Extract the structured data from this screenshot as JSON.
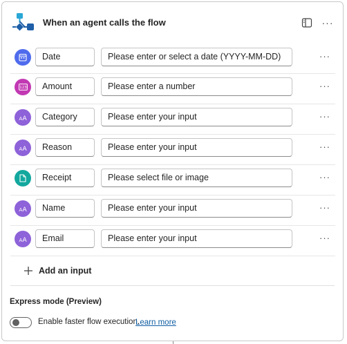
{
  "header": {
    "title": "When an agent calls the flow",
    "icon": "agent-trigger-icon",
    "panel_icon": "panel-toggle-icon",
    "more_label": "···"
  },
  "inputs": [
    {
      "name": "Date",
      "hint": "Please enter or select a date (YYYY-MM-DD)",
      "icon": "calendar-icon",
      "color": "#4f6bed"
    },
    {
      "name": "Amount",
      "hint": "Please enter a number",
      "icon": "number-icon",
      "color": "#c239b3"
    },
    {
      "name": "Category",
      "hint": "Please enter your input",
      "icon": "text-icon",
      "color": "#8e62d9"
    },
    {
      "name": "Reason",
      "hint": "Please enter your input",
      "icon": "text-icon",
      "color": "#8e62d9"
    },
    {
      "name": "Receipt",
      "hint": "Please select file or image",
      "icon": "file-icon",
      "color": "#13a89e"
    },
    {
      "name": "Name",
      "hint": "Please enter your input",
      "icon": "text-icon",
      "color": "#8e62d9"
    },
    {
      "name": "Email",
      "hint": "Please enter your input",
      "icon": "text-icon",
      "color": "#8e62d9"
    }
  ],
  "row_more_label": "···",
  "add_input_label": "Add an input",
  "express": {
    "title": "Express mode (Preview)",
    "toggle_label": "Enable faster flow execution.",
    "toggle_on": false,
    "learn_more": "Learn more"
  },
  "colors": {
    "accent_blue": "#0f6cbd",
    "link": "#115ea3"
  }
}
